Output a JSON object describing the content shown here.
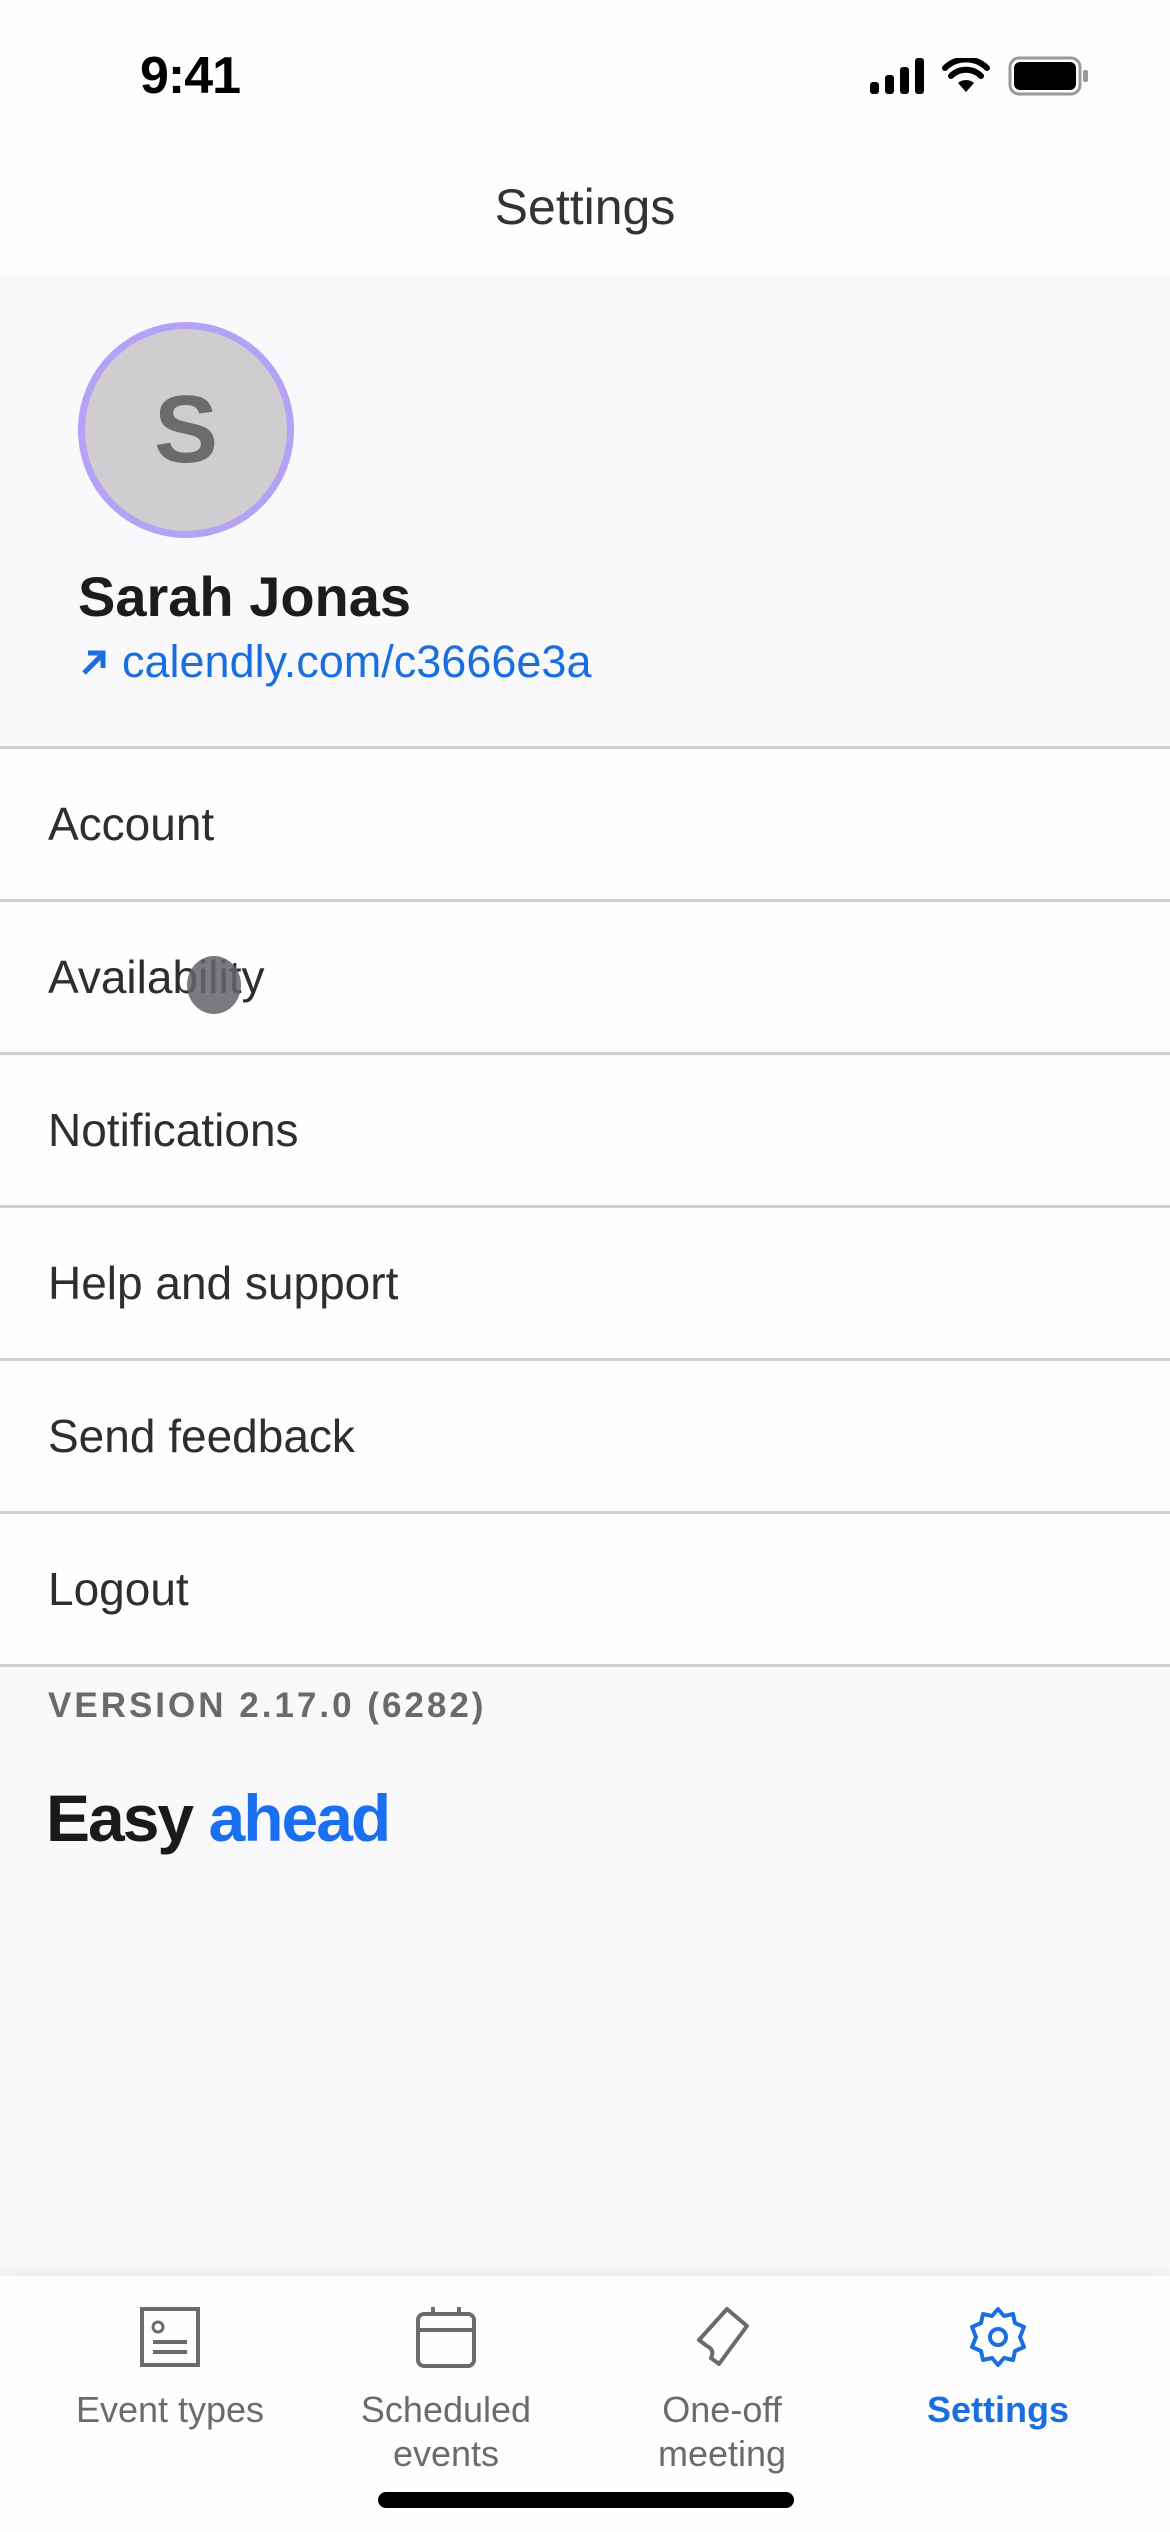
{
  "status_bar": {
    "time": "9:41"
  },
  "nav": {
    "title": "Settings"
  },
  "profile": {
    "avatar_initial": "S",
    "name": "Sarah Jonas",
    "link": "calendly.com/c3666e3a",
    "link_icon": "arrow-up-right-icon"
  },
  "menu": {
    "items": [
      {
        "label": "Account"
      },
      {
        "label": "Availability"
      },
      {
        "label": "Notifications"
      },
      {
        "label": "Help and support"
      },
      {
        "label": "Send feedback"
      },
      {
        "label": "Logout"
      }
    ]
  },
  "footer": {
    "version": "VERSION 2.17.0 (6282)",
    "logo_part1": "Easy",
    "logo_part2": "ahead"
  },
  "tab_bar": {
    "tabs": [
      {
        "label": "Event types",
        "icon": "event-types-icon",
        "active": false
      },
      {
        "label": "Scheduled\nevents",
        "line1": "Scheduled",
        "line2": "events",
        "icon": "calendar-icon",
        "active": false
      },
      {
        "label": "One-off\nmeeting",
        "line1": "One-off",
        "line2": "meeting",
        "icon": "ticket-icon",
        "active": false
      },
      {
        "label": "Settings",
        "icon": "gear-icon",
        "active": true
      }
    ]
  },
  "colors": {
    "accent": "#1a6fe0",
    "avatar_ring": "#b3a2f5",
    "background": "#f9f8fb",
    "divider": "#cfcfd1"
  }
}
